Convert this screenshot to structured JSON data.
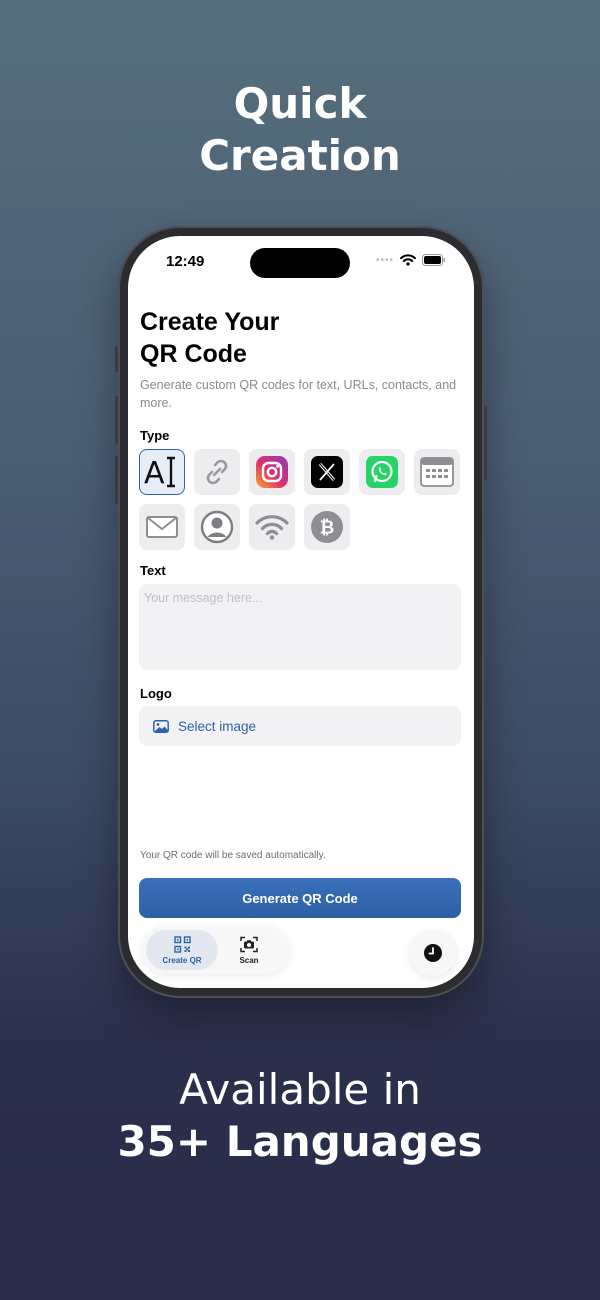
{
  "headline_top": [
    "Quick",
    "Creation"
  ],
  "headline_bottom": [
    "Available in",
    "35+ Languages"
  ],
  "status_bar": {
    "time": "12:49"
  },
  "page": {
    "title_line1": "Create Your",
    "title_line2": "QR Code",
    "subtitle": "Generate custom QR codes for text, URLs, contacts, and more."
  },
  "type_section": {
    "label": "Type",
    "options": [
      "text-icon",
      "link-icon",
      "instagram-icon",
      "x-icon",
      "whatsapp-icon",
      "calendar-icon",
      "mail-icon",
      "contact-icon",
      "wifi-icon",
      "bitcoin-icon"
    ],
    "selected": "text-icon"
  },
  "text_section": {
    "label": "Text",
    "placeholder": "Your message here..."
  },
  "logo_section": {
    "label": "Logo",
    "button_label": "Select image"
  },
  "note": "Your QR code will be saved automatically.",
  "generate_button": "Generate QR Code",
  "tabs": [
    {
      "label": "Create QR",
      "icon": "qr-icon",
      "active": true
    },
    {
      "label": "Scan",
      "icon": "scan-icon",
      "active": false
    }
  ],
  "history_button": {
    "icon": "clock-icon"
  },
  "colors": {
    "accent": "#2F64AD",
    "instagram": "#E1306C",
    "whatsapp": "#25D366"
  }
}
